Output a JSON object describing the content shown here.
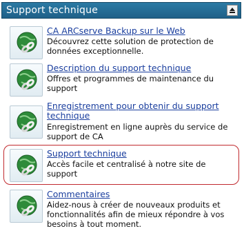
{
  "panel": {
    "title": "Support technique",
    "collapse_icon": "collapse-up-icon"
  },
  "items": [
    {
      "link": "CA ARCserve Backup sur le Web",
      "desc": "Découvrez cette solution de protection de données exceptionnelle.",
      "icon": "globe-link-icon"
    },
    {
      "link": "Description du support technique",
      "desc": "Offres et programmes de maintenance du support",
      "icon": "globe-link-icon"
    },
    {
      "link": "Enregistrement pour obtenir du support technique",
      "desc": "Enregistrement en ligne auprès du service de support de CA",
      "icon": "globe-link-icon"
    },
    {
      "link": "Support technique",
      "desc": "Accès facile et centralisé à notre site de support",
      "icon": "globe-link-icon",
      "highlighted": true
    },
    {
      "link": "Commentaires",
      "desc": "Aidez-nous à créer de nouveaux produits et fonctionnalités afin de mieux répondre à vos besoins à tout moment.",
      "icon": "globe-link-icon"
    }
  ],
  "colors": {
    "title_bar": "#2b7aa4",
    "link": "#1a3e9e",
    "highlight_border": "#c0282d",
    "globe": "#2e8b3a"
  }
}
